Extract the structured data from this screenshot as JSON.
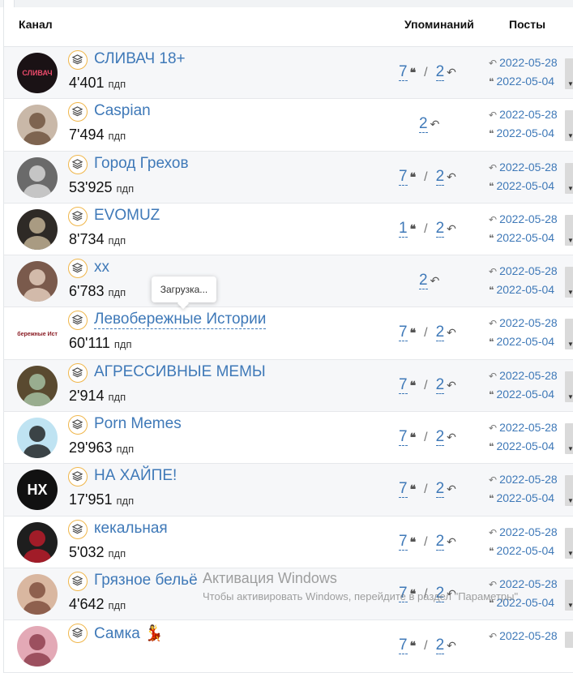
{
  "header": {
    "channel": "Канал",
    "mentions": "Упоминаний",
    "posts": "Посты"
  },
  "rows": [
    {
      "name": "СЛИВАЧ 18+",
      "subs": "4'401",
      "unit": "пдп",
      "m1": "7",
      "m2": "2",
      "d1": "2022-05-28",
      "d2": "2022-05-04",
      "avatar_text": "СЛИВАЧ"
    },
    {
      "name": "Caspian",
      "subs": "7'494",
      "unit": "пдп",
      "m1": "",
      "m2": "2",
      "d1": "2022-05-28",
      "d2": "2022-05-04",
      "avatar_text": ""
    },
    {
      "name": "Город Грехов",
      "subs": "53'925",
      "unit": "пдп",
      "m1": "7",
      "m2": "2",
      "d1": "2022-05-28",
      "d2": "2022-05-04",
      "avatar_text": ""
    },
    {
      "name": "EVOMUZ",
      "subs": "8'734",
      "unit": "пдп",
      "m1": "1",
      "m2": "2",
      "d1": "2022-05-28",
      "d2": "2022-05-04",
      "avatar_text": ""
    },
    {
      "name": "хх",
      "subs": "6'783",
      "unit": "пдп",
      "m1": "",
      "m2": "2",
      "d1": "2022-05-28",
      "d2": "2022-05-04",
      "avatar_text": ""
    },
    {
      "name": "Левобережные Истории",
      "subs": "60'111",
      "unit": "пдп",
      "m1": "7",
      "m2": "2",
      "d1": "2022-05-28",
      "d2": "2022-05-04",
      "avatar_text": "Левобережные Истории"
    },
    {
      "name": "АГРЕССИВНЫЕ МЕМЫ",
      "subs": "2'914",
      "unit": "пдп",
      "m1": "7",
      "m2": "2",
      "d1": "2022-05-28",
      "d2": "2022-05-04",
      "avatar_text": ""
    },
    {
      "name": "Porn Memes",
      "subs": "29'963",
      "unit": "пдп",
      "m1": "7",
      "m2": "2",
      "d1": "2022-05-28",
      "d2": "2022-05-04",
      "avatar_text": ""
    },
    {
      "name": "НА ХАЙПЕ!",
      "subs": "17'951",
      "unit": "пдп",
      "m1": "7",
      "m2": "2",
      "d1": "2022-05-28",
      "d2": "2022-05-04",
      "avatar_text": "HX"
    },
    {
      "name": "кекальная",
      "subs": "5'032",
      "unit": "пдп",
      "m1": "7",
      "m2": "2",
      "d1": "2022-05-28",
      "d2": "2022-05-04",
      "avatar_text": ""
    },
    {
      "name": "Грязное бельё",
      "subs": "4'642",
      "unit": "пдп",
      "m1": "7",
      "m2": "2",
      "d1": "2022-05-28",
      "d2": "2022-05-04",
      "avatar_text": ""
    },
    {
      "name": "Самка 💃",
      "subs": "",
      "unit": "",
      "m1": "7",
      "m2": "2",
      "d1": "2022-05-28",
      "d2": "",
      "avatar_text": ""
    }
  ],
  "tooltip": "Загрузка...",
  "watermark": {
    "title": "Активация Windows",
    "text": "Чтобы активировать Windows, перейдите в раздел \"Параметры\""
  }
}
